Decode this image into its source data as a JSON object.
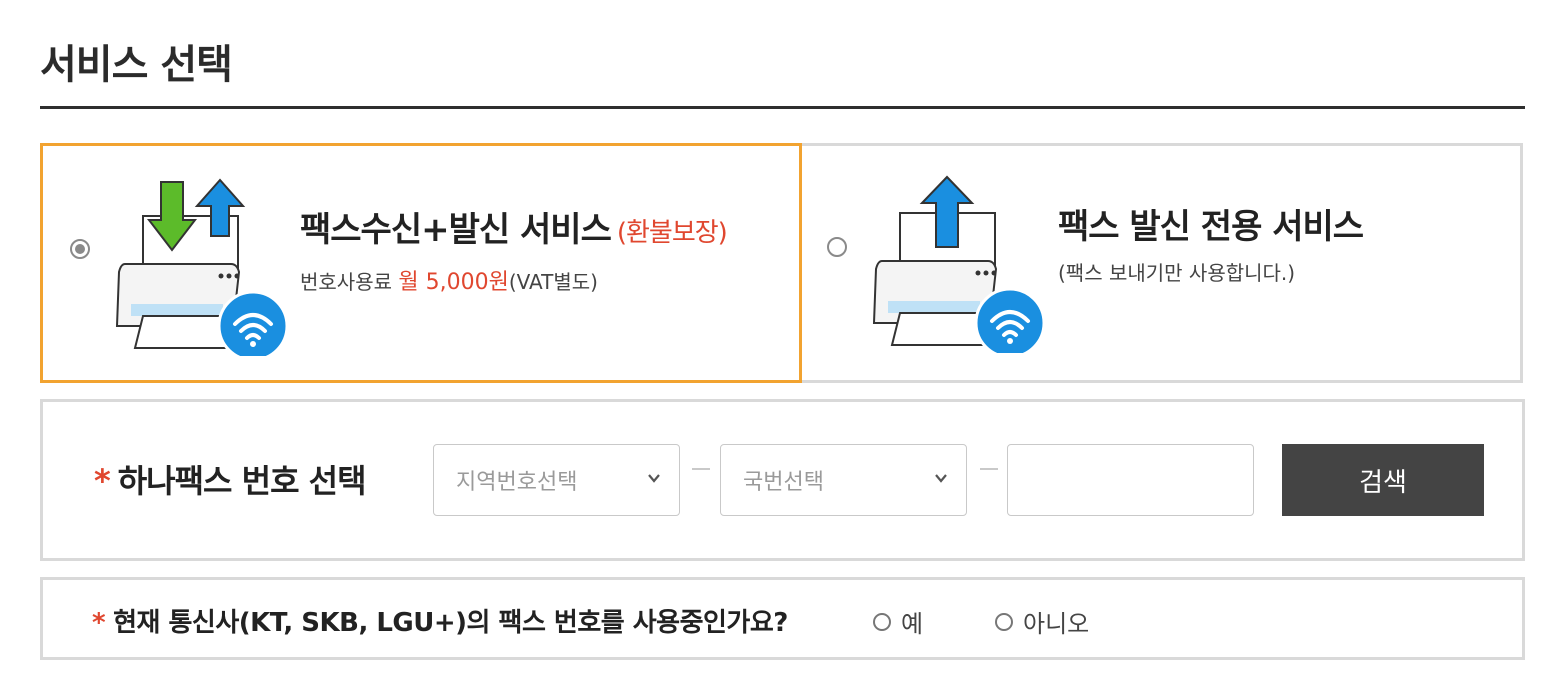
{
  "page": {
    "title": "서비스 선택"
  },
  "services": [
    {
      "title": "팩스수신+발신 서비스",
      "badge": "(환불보장)",
      "sub_prefix": "번호사용료 ",
      "sub_price": "월 5,000원",
      "sub_suffix": "(VAT별도)",
      "selected": true,
      "icon": "fax-send-receive-icon"
    },
    {
      "title": "팩스 발신 전용 서비스",
      "sub": "(팩스 보내기만 사용합니다.)",
      "selected": false,
      "icon": "fax-send-only-icon"
    }
  ],
  "number_select": {
    "asterisk": "*",
    "label": "하나팩스 번호 선택",
    "area_placeholder": "지역번호선택",
    "prefix_placeholder": "국번선택",
    "number_value": "",
    "search_label": "검색"
  },
  "carrier": {
    "asterisk": "*",
    "question": "현재 통신사(KT, SKB, LGU+)의 팩스 번호를 사용중인가요?",
    "yes_label": "예",
    "no_label": "아니오"
  },
  "colors": {
    "accent": "#f2a330",
    "highlight": "#e0472f",
    "button": "#444444",
    "wifi": "#1a8fe0",
    "arrow_green": "#5cbb2a",
    "arrow_blue": "#1a8fe0"
  }
}
